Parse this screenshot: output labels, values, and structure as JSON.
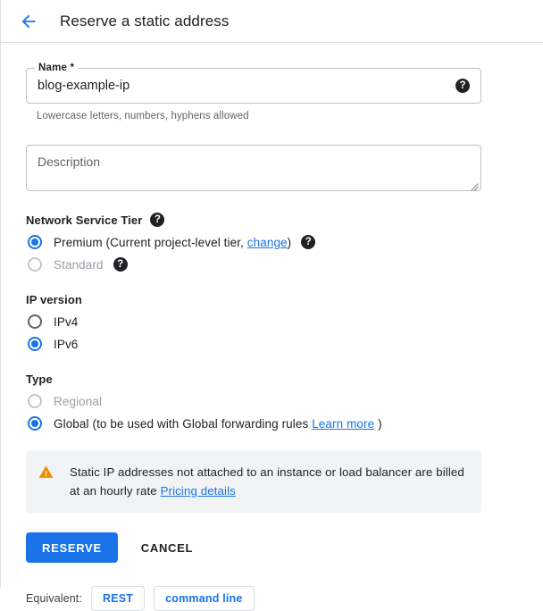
{
  "header": {
    "back_icon": "arrow-back-icon",
    "title": "Reserve a static address"
  },
  "colors": {
    "accent": "#1a73e8",
    "warning": "#ef8c00",
    "text": "#202124",
    "muted": "#5f6368",
    "disabled": "#9aa0a6",
    "banner_bg": "#f1f3f4",
    "border": "#dadce0"
  },
  "name_field": {
    "label": "Name *",
    "value": "blog-example-ip",
    "placeholder": "Name",
    "help_glyph": "?",
    "hint": "Lowercase letters, numbers, hyphens allowed"
  },
  "description_field": {
    "placeholder": "Description",
    "value": ""
  },
  "network_service_tier": {
    "title": "Network Service Tier",
    "help_glyph": "?",
    "options": [
      {
        "label_before": "Premium (Current project-level tier, ",
        "link": "change",
        "label_after": ")",
        "selected": true,
        "disabled": false,
        "help_glyph": "?"
      },
      {
        "label_before": "Standard",
        "link": "",
        "label_after": "",
        "selected": false,
        "disabled": true,
        "help_glyph": "?"
      }
    ]
  },
  "ip_version": {
    "title": "IP version",
    "options": [
      {
        "label": "IPv4",
        "selected": false,
        "disabled": false
      },
      {
        "label": "IPv6",
        "selected": true,
        "disabled": false
      }
    ]
  },
  "type": {
    "title": "Type",
    "options": [
      {
        "label_before": "Regional",
        "link": "",
        "label_after": "",
        "selected": false,
        "disabled": true
      },
      {
        "label_before": "Global (to be used with Global forwarding rules ",
        "link": "Learn more",
        "label_after": " )",
        "selected": true,
        "disabled": false
      }
    ]
  },
  "warning_banner": {
    "icon": "warning-triangle-icon",
    "text_before": "Static IP addresses not attached to an instance or load balancer are billed at an hourly rate ",
    "link": "Pricing details"
  },
  "actions": {
    "primary_label": "RESERVE",
    "secondary_label": "CANCEL"
  },
  "equivalent": {
    "label": "Equivalent:",
    "buttons": [
      "REST",
      "command line"
    ]
  }
}
